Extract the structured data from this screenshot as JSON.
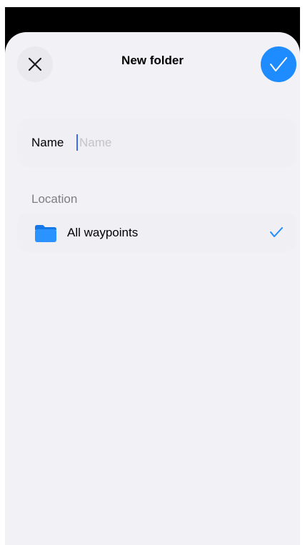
{
  "header": {
    "title": "New folder",
    "close_icon": "close-icon",
    "confirm_icon": "checkmark-icon"
  },
  "name_field": {
    "label": "Name",
    "placeholder": "Name",
    "value": ""
  },
  "location": {
    "section_label": "Location",
    "items": [
      {
        "label": "All waypoints",
        "icon": "folder-icon",
        "selected": true
      }
    ]
  },
  "colors": {
    "accent": "#1e8cff",
    "background": "#f2f2f6",
    "row": "#efeff4",
    "secondary_text": "#7d7d82"
  }
}
